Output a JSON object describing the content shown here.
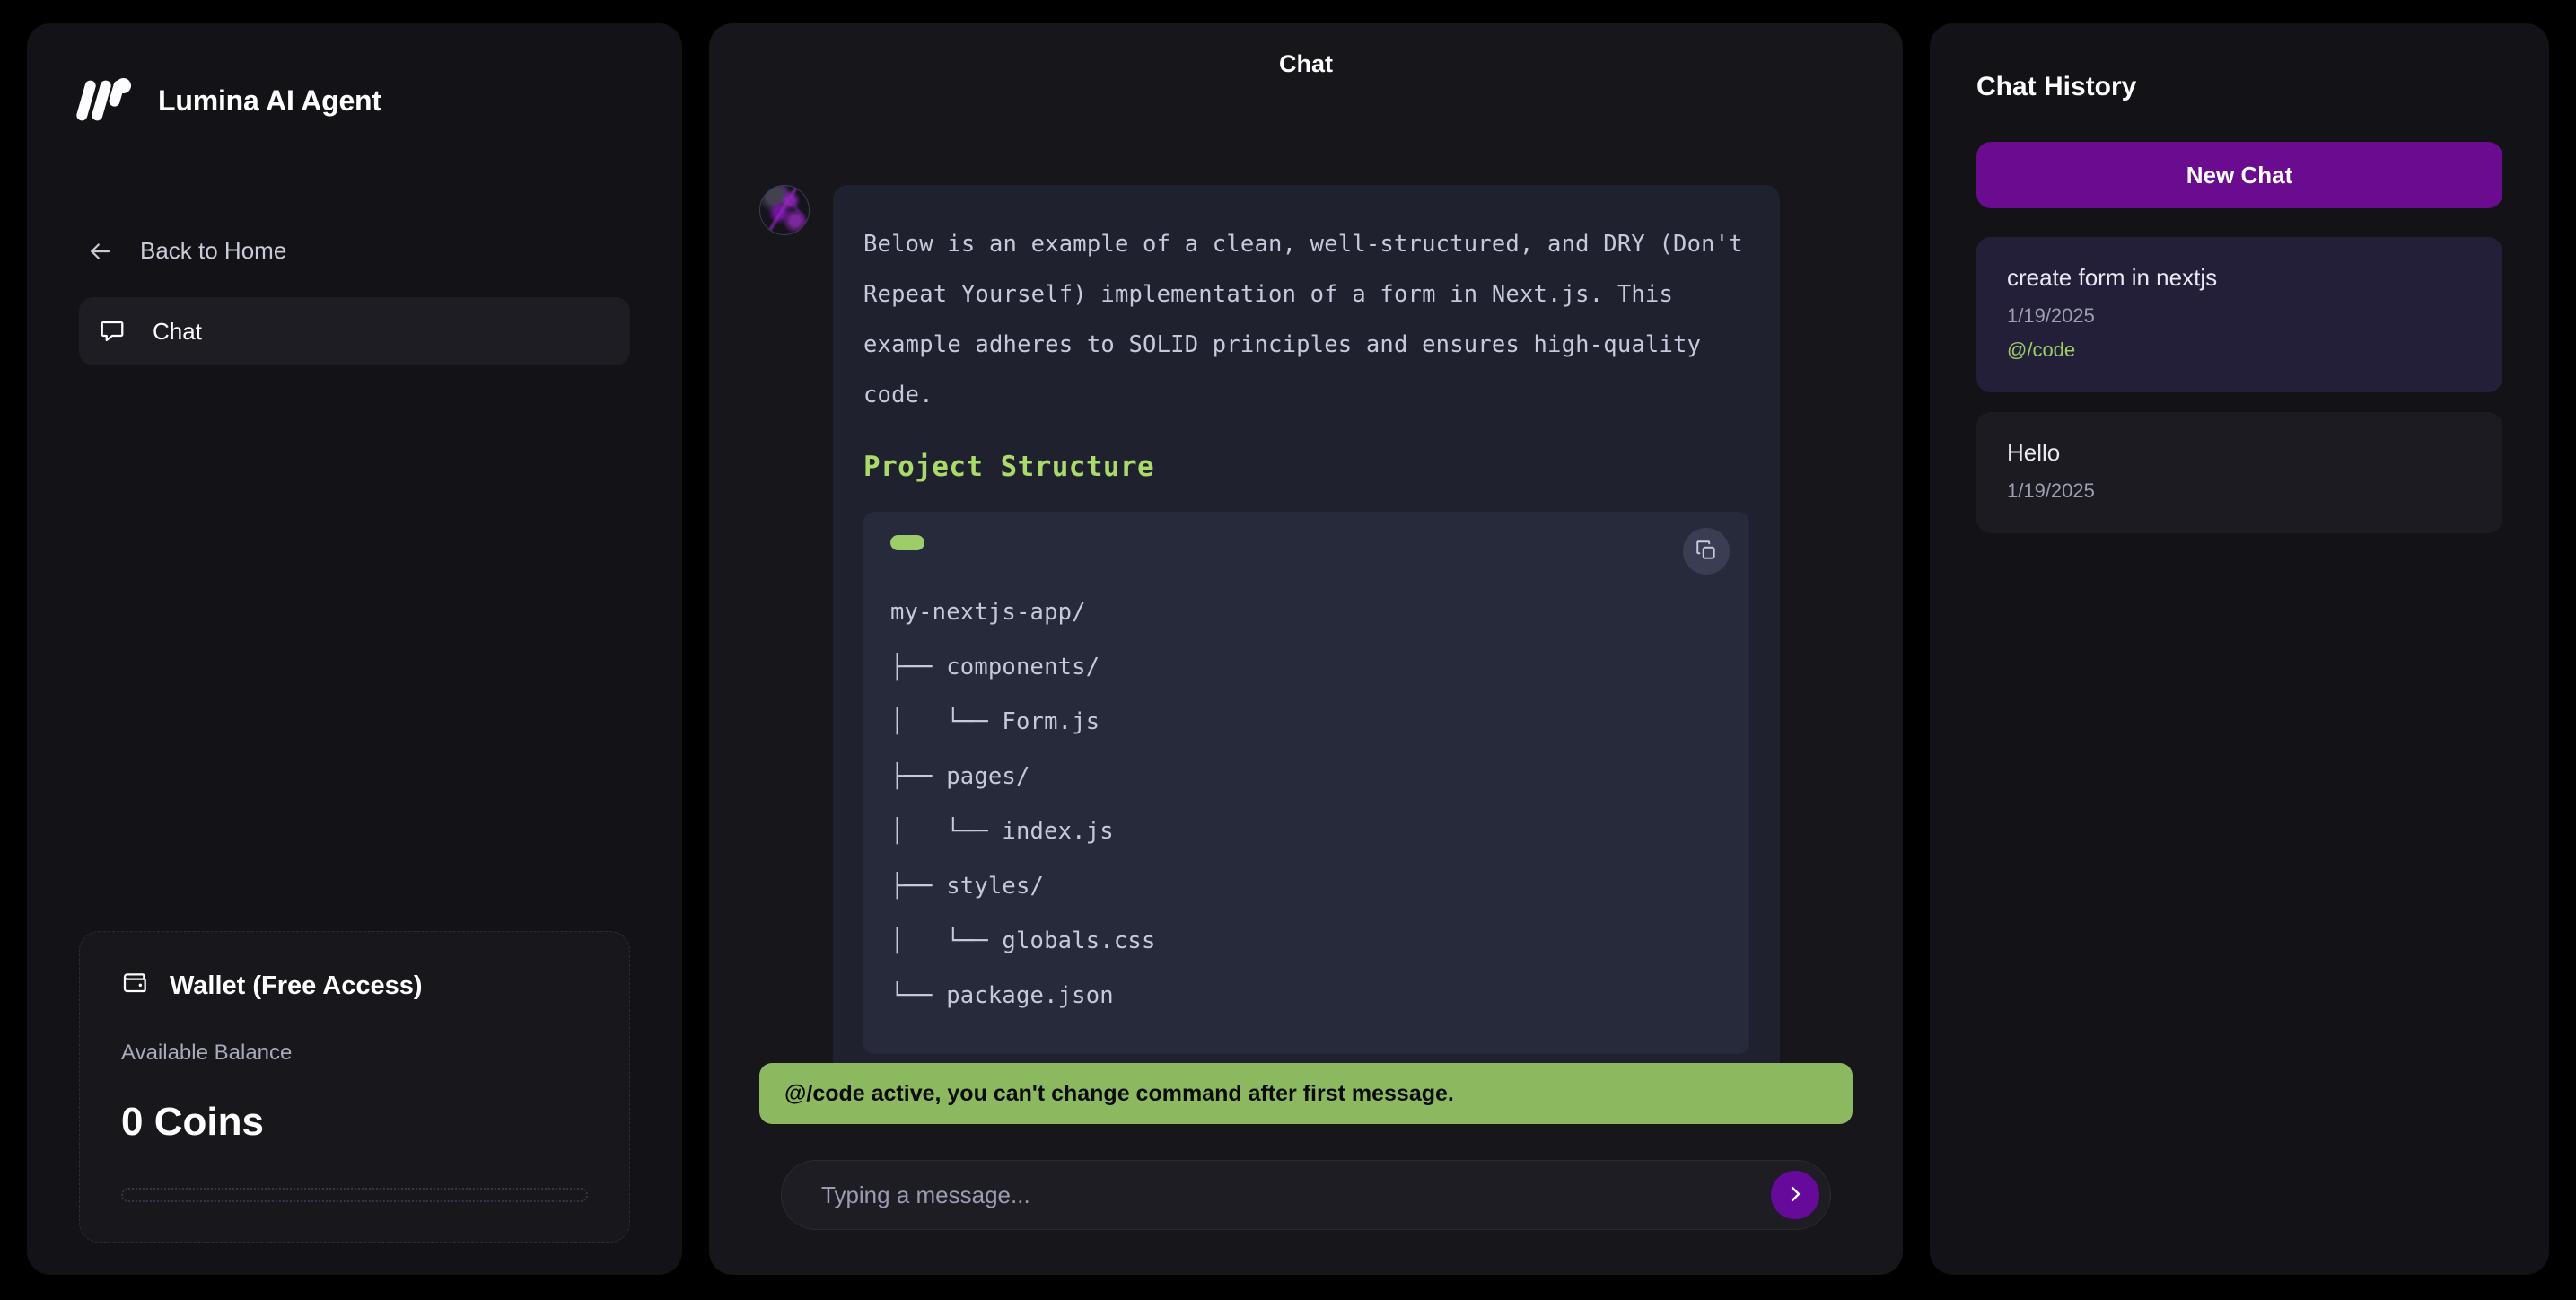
{
  "brand": {
    "name": "Lumina AI Agent",
    "logo_icon": "lumina-w-logo-icon"
  },
  "sidebar": {
    "back_label": "Back to Home",
    "back_icon": "arrow-left-icon",
    "items": [
      {
        "label": "Chat",
        "icon": "chat-bubble-icon",
        "active": true
      }
    ],
    "wallet": {
      "icon": "wallet-icon",
      "title": "Wallet (Free Access)",
      "balance_label": "Available Balance",
      "amount": "0 Coins",
      "progress_percent": 0
    }
  },
  "chat": {
    "header_title": "Chat",
    "message": {
      "author_avatar_icon": "assistant-avatar",
      "paragraph": "Below is an example of a clean, well-structured, and DRY (Don't Repeat Yourself) implementation of a form in Next.js. This example adheres to SOLID principles and ensures high-quality code.",
      "heading": "Project Structure",
      "code_block": {
        "language_badge": "",
        "copy_icon": "copy-icon",
        "content": "my-nextjs-app/\n├── components/\n│   └── Form.js\n├── pages/\n│   └── index.js\n├── styles/\n│   └── globals.css\n└── package.json"
      }
    },
    "banner": {
      "text": "@/code active, you can't change command after first message.",
      "background_color": "#8cb860"
    },
    "composer": {
      "placeholder": "Typing a message...",
      "value": "",
      "send_icon": "chevron-right-icon",
      "send_color": "#650a9b"
    }
  },
  "history": {
    "title": "Chat History",
    "new_chat_label": "New Chat",
    "new_chat_color": "#6b0b8f",
    "items": [
      {
        "title": "create form in nextjs",
        "date": "1/19/2025",
        "command": "@/code",
        "selected": true
      },
      {
        "title": "Hello",
        "date": "1/19/2025",
        "command": "",
        "selected": false
      }
    ]
  },
  "theme": {
    "page_bg": "#000000",
    "panel_bg": "#131317",
    "bubble_bg": "#20212e",
    "code_bg": "#272a3a",
    "accent_purple": "#6b0b8f",
    "accent_green": "#9ccd68"
  }
}
